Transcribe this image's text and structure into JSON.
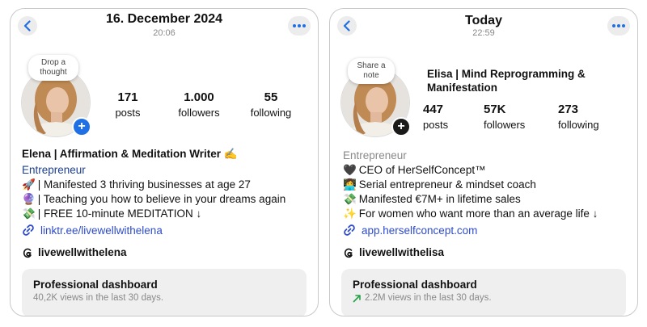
{
  "cards": [
    {
      "header": {
        "date": "16. December 2024",
        "time": "20:06"
      },
      "note_text": "Drop a thought",
      "stats": [
        {
          "value": "171",
          "label": "posts"
        },
        {
          "value": "1.000",
          "label": "followers"
        },
        {
          "value": "55",
          "label": "following"
        }
      ],
      "name": "Elena | Affirmation & Meditation Writer ✍️",
      "category": "Entrepreneur",
      "bio": [
        {
          "emoji": "🚀",
          "text": "| Manifested 3 thriving businesses at age 27"
        },
        {
          "emoji": "🔮",
          "text": "| Teaching you how to believe in your dreams again"
        },
        {
          "emoji": "💸",
          "text": "| FREE 10-minute MEDITATION ↓"
        }
      ],
      "link": "linktr.ee/livewellwithelena",
      "threads_handle": "livewellwithelena",
      "dashboard": {
        "title": "Professional dashboard",
        "subtitle": "40,2K views in the last 30 days."
      }
    },
    {
      "header": {
        "date": "Today",
        "time": "22:59"
      },
      "note_text": "Share a note",
      "stats": [
        {
          "value": "447",
          "label": "posts"
        },
        {
          "value": "57K",
          "label": "followers"
        },
        {
          "value": "273",
          "label": "following"
        }
      ],
      "name": "Elisa | Mind Reprogramming & Manifestation",
      "category": "Entrepreneur",
      "bio": [
        {
          "emoji": "🖤",
          "text": "CEO of HerSelfConcept™"
        },
        {
          "emoji": "👩‍💻",
          "text": "Serial entrepreneur & mindset coach"
        },
        {
          "emoji": "💸",
          "text": "Manifested €7M+ in lifetime sales"
        },
        {
          "emoji": "✨",
          "text": "For women who want more than an average life ↓"
        }
      ],
      "link": "app.herselfconcept.com",
      "threads_handle": "livewellwithelisa",
      "dashboard": {
        "title": "Professional dashboard",
        "subtitle": "2.2M views in the last 30 days."
      }
    }
  ],
  "colors": {
    "accent_blue": "#1f6fe5",
    "category_blue": "#1c3f8f",
    "link_blue": "#2f4cc9",
    "badge_dark": "#1a1a1a",
    "trend_green": "#23a047"
  },
  "icons": {
    "back": "chevron-left-icon",
    "more": "more-horizontal-icon",
    "link": "link-icon",
    "threads": "threads-logo-icon",
    "trend": "trending-up-arrow-icon"
  }
}
